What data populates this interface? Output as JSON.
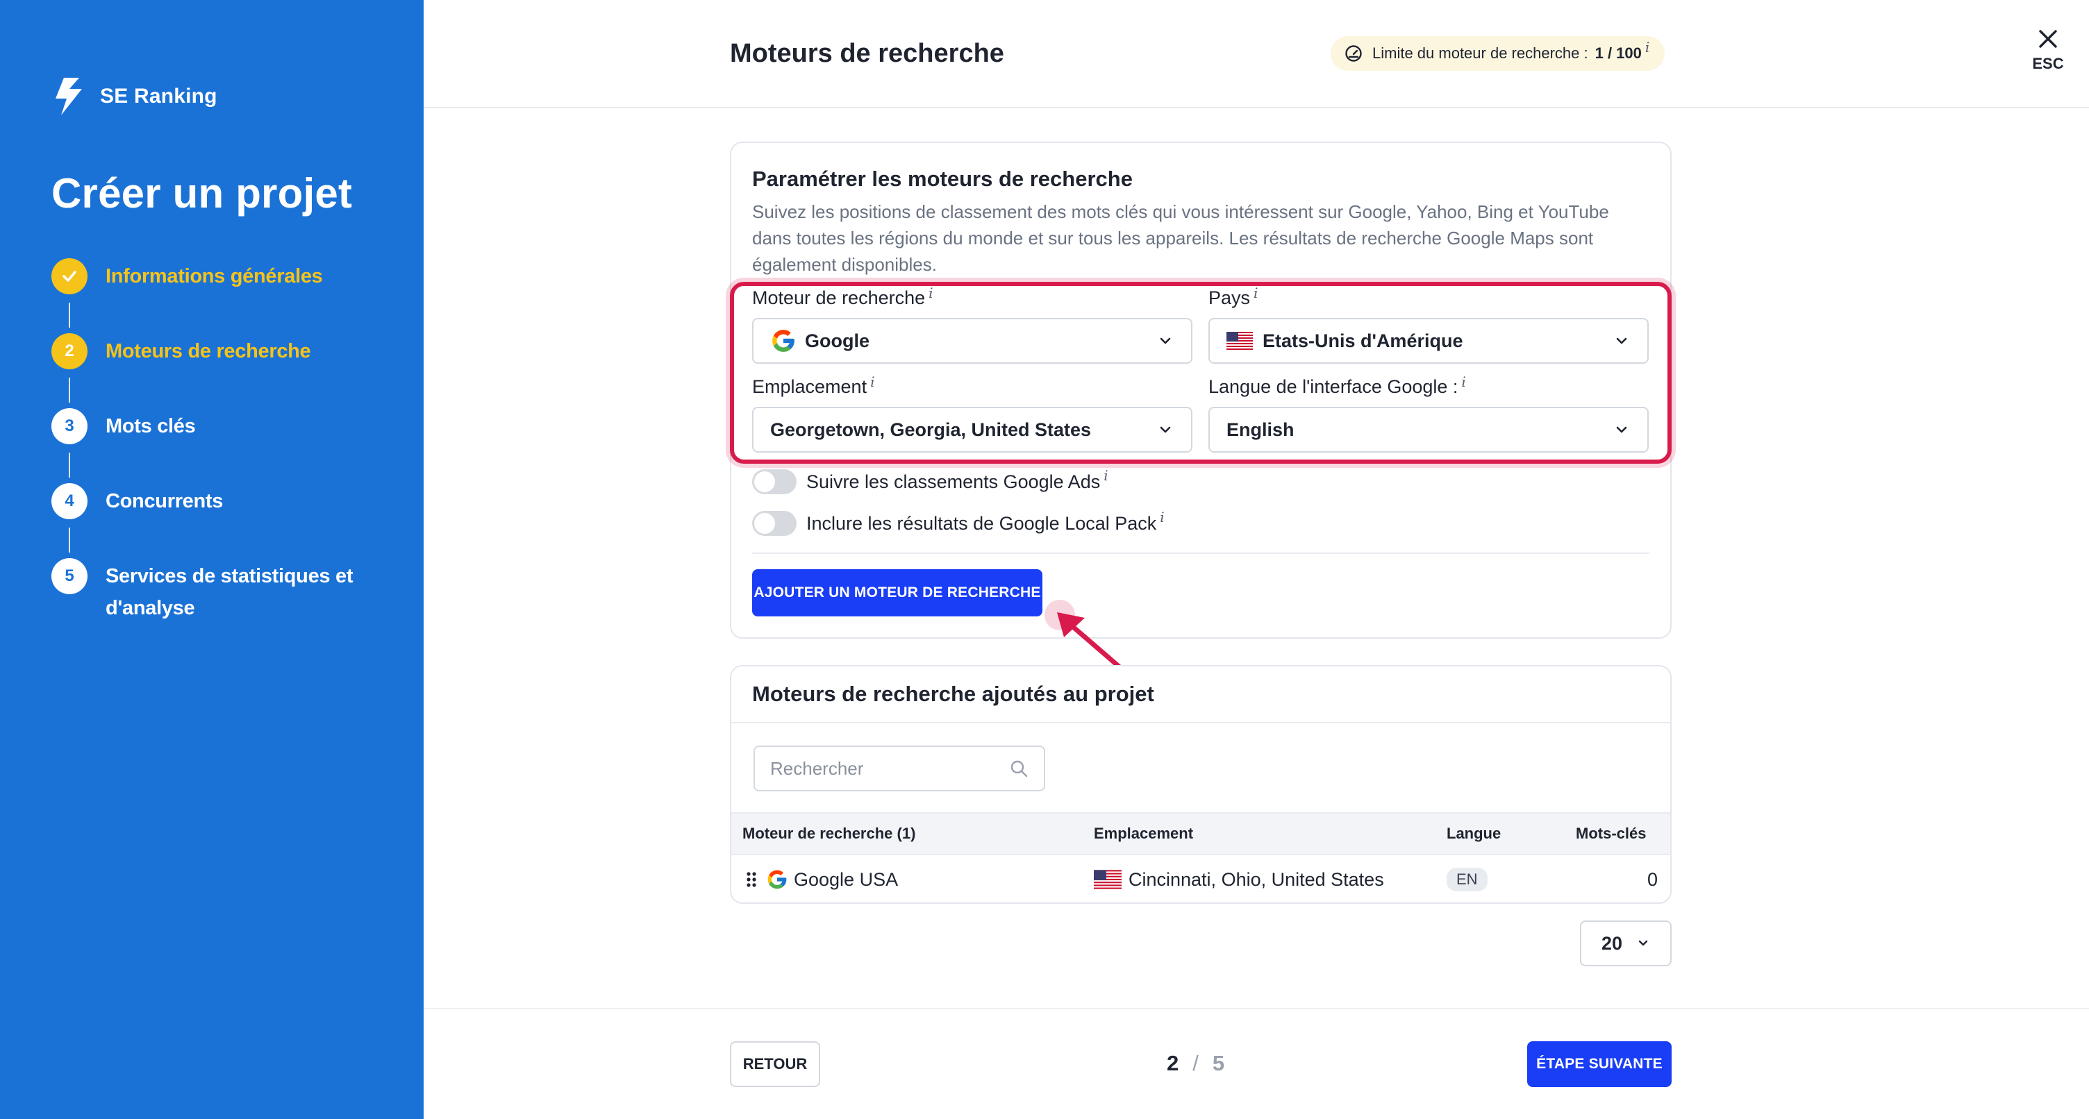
{
  "sidebar": {
    "brand": "SE Ranking",
    "title": "Créer un projet",
    "steps": [
      {
        "number": "1",
        "label": "Informations générales",
        "state": "done"
      },
      {
        "number": "2",
        "label": "Moteurs de recherche",
        "state": "active"
      },
      {
        "number": "3",
        "label": "Mots clés",
        "state": "todo"
      },
      {
        "number": "4",
        "label": "Concurrents",
        "state": "todo"
      },
      {
        "number": "5",
        "label": "Services de statistiques et d'analyse",
        "state": "todo"
      }
    ]
  },
  "header": {
    "title": "Moteurs de recherche",
    "limit_label": "Limite du moteur de recherche :",
    "limit_value": "1 / 100",
    "info": "i",
    "close_label": "ESC"
  },
  "setup": {
    "title": "Paramétrer les moteurs de recherche",
    "description": "Suivez les positions de classement des mots clés qui vous intéressent sur Google, Yahoo, Bing et YouTube dans toutes les régions du monde et sur tous les appareils. Les résultats de recherche Google Maps sont également disponibles.",
    "engine_label": "Moteur de recherche",
    "engine_value": "Google",
    "country_label": "Pays",
    "country_value": "Etats-Unis d'Amérique",
    "location_label": "Emplacement",
    "location_value": "Georgetown, Georgia, United States",
    "language_label": "Langue de l'interface Google :",
    "language_value": "English",
    "toggle_ads_label": "Suivre les classements Google Ads",
    "toggle_local_label": "Inclure les résultats de Google Local Pack",
    "add_button": "AJOUTER UN MOTEUR DE RECHERCHE",
    "info": "i"
  },
  "added": {
    "title": "Moteurs de recherche ajoutés au projet",
    "search_placeholder": "Rechercher",
    "columns": [
      "Moteur de recherche (1)",
      "Emplacement",
      "Langue",
      "Mots-clés"
    ],
    "rows": [
      {
        "engine": "Google USA",
        "location": "Cincinnati, Ohio, United States",
        "language": "EN",
        "keywords": "0"
      }
    ],
    "page_size": "20"
  },
  "footer": {
    "back_button": "RETOUR",
    "current_step": "2",
    "separator": "/",
    "total_steps": "5",
    "next_button": "ÉTAPE SUIVANTE"
  },
  "colors": {
    "sidebar_bg": "#1b72d6",
    "accent_yellow": "#f5c319",
    "primary_button": "#1a3ef5",
    "highlight": "#d81b4c"
  }
}
